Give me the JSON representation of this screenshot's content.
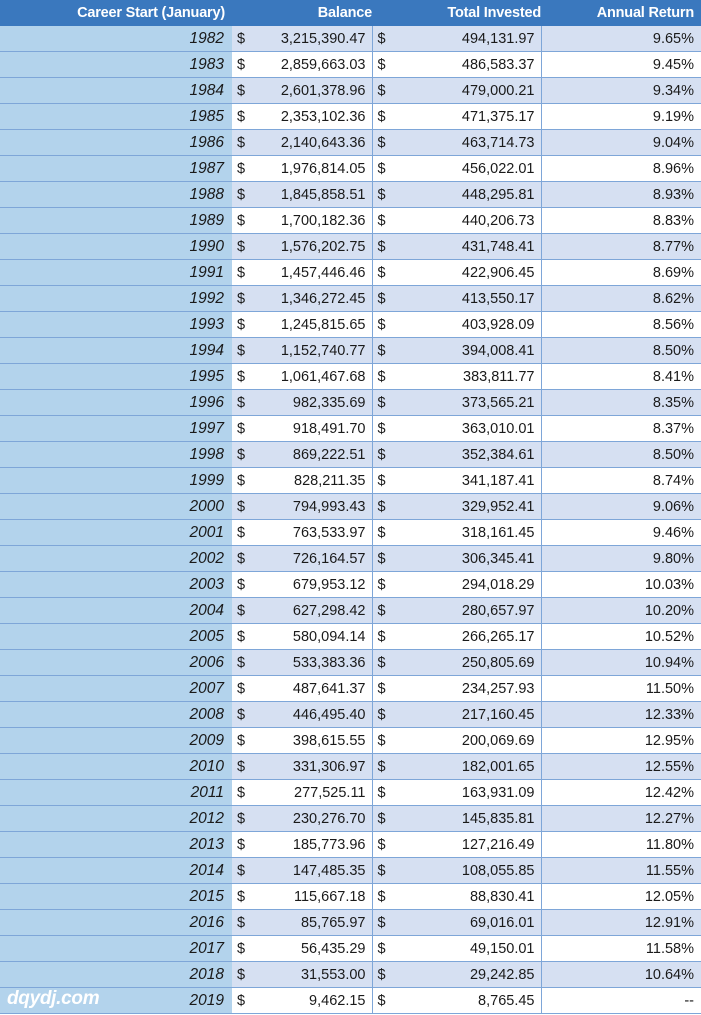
{
  "table": {
    "headers": {
      "year": "Career Start (January)",
      "balance": "Balance",
      "invested": "Total Invested",
      "return": "Annual Return"
    },
    "currency_symbol": "$",
    "rows": [
      {
        "year": "1982",
        "balance": "3,215,390.47",
        "invested": "494,131.97",
        "return": "9.65%"
      },
      {
        "year": "1983",
        "balance": "2,859,663.03",
        "invested": "486,583.37",
        "return": "9.45%"
      },
      {
        "year": "1984",
        "balance": "2,601,378.96",
        "invested": "479,000.21",
        "return": "9.34%"
      },
      {
        "year": "1985",
        "balance": "2,353,102.36",
        "invested": "471,375.17",
        "return": "9.19%"
      },
      {
        "year": "1986",
        "balance": "2,140,643.36",
        "invested": "463,714.73",
        "return": "9.04%"
      },
      {
        "year": "1987",
        "balance": "1,976,814.05",
        "invested": "456,022.01",
        "return": "8.96%"
      },
      {
        "year": "1988",
        "balance": "1,845,858.51",
        "invested": "448,295.81",
        "return": "8.93%"
      },
      {
        "year": "1989",
        "balance": "1,700,182.36",
        "invested": "440,206.73",
        "return": "8.83%"
      },
      {
        "year": "1990",
        "balance": "1,576,202.75",
        "invested": "431,748.41",
        "return": "8.77%"
      },
      {
        "year": "1991",
        "balance": "1,457,446.46",
        "invested": "422,906.45",
        "return": "8.69%"
      },
      {
        "year": "1992",
        "balance": "1,346,272.45",
        "invested": "413,550.17",
        "return": "8.62%"
      },
      {
        "year": "1993",
        "balance": "1,245,815.65",
        "invested": "403,928.09",
        "return": "8.56%"
      },
      {
        "year": "1994",
        "balance": "1,152,740.77",
        "invested": "394,008.41",
        "return": "8.50%"
      },
      {
        "year": "1995",
        "balance": "1,061,467.68",
        "invested": "383,811.77",
        "return": "8.41%"
      },
      {
        "year": "1996",
        "balance": "982,335.69",
        "invested": "373,565.21",
        "return": "8.35%"
      },
      {
        "year": "1997",
        "balance": "918,491.70",
        "invested": "363,010.01",
        "return": "8.37%"
      },
      {
        "year": "1998",
        "balance": "869,222.51",
        "invested": "352,384.61",
        "return": "8.50%"
      },
      {
        "year": "1999",
        "balance": "828,211.35",
        "invested": "341,187.41",
        "return": "8.74%"
      },
      {
        "year": "2000",
        "balance": "794,993.43",
        "invested": "329,952.41",
        "return": "9.06%"
      },
      {
        "year": "2001",
        "balance": "763,533.97",
        "invested": "318,161.45",
        "return": "9.46%"
      },
      {
        "year": "2002",
        "balance": "726,164.57",
        "invested": "306,345.41",
        "return": "9.80%"
      },
      {
        "year": "2003",
        "balance": "679,953.12",
        "invested": "294,018.29",
        "return": "10.03%"
      },
      {
        "year": "2004",
        "balance": "627,298.42",
        "invested": "280,657.97",
        "return": "10.20%"
      },
      {
        "year": "2005",
        "balance": "580,094.14",
        "invested": "266,265.17",
        "return": "10.52%"
      },
      {
        "year": "2006",
        "balance": "533,383.36",
        "invested": "250,805.69",
        "return": "10.94%"
      },
      {
        "year": "2007",
        "balance": "487,641.37",
        "invested": "234,257.93",
        "return": "11.50%"
      },
      {
        "year": "2008",
        "balance": "446,495.40",
        "invested": "217,160.45",
        "return": "12.33%"
      },
      {
        "year": "2009",
        "balance": "398,615.55",
        "invested": "200,069.69",
        "return": "12.95%"
      },
      {
        "year": "2010",
        "balance": "331,306.97",
        "invested": "182,001.65",
        "return": "12.55%"
      },
      {
        "year": "2011",
        "balance": "277,525.11",
        "invested": "163,931.09",
        "return": "12.42%"
      },
      {
        "year": "2012",
        "balance": "230,276.70",
        "invested": "145,835.81",
        "return": "12.27%"
      },
      {
        "year": "2013",
        "balance": "185,773.96",
        "invested": "127,216.49",
        "return": "11.80%"
      },
      {
        "year": "2014",
        "balance": "147,485.35",
        "invested": "108,055.85",
        "return": "11.55%"
      },
      {
        "year": "2015",
        "balance": "115,667.18",
        "invested": "88,830.41",
        "return": "12.05%"
      },
      {
        "year": "2016",
        "balance": "85,765.97",
        "invested": "69,016.01",
        "return": "12.91%"
      },
      {
        "year": "2017",
        "balance": "56,435.29",
        "invested": "49,150.01",
        "return": "11.58%"
      },
      {
        "year": "2018",
        "balance": "31,553.00",
        "invested": "29,242.85",
        "return": "10.64%"
      },
      {
        "year": "2019",
        "balance": "9,462.15",
        "invested": "8,765.45",
        "return": "--"
      }
    ]
  },
  "watermark": {
    "text": "dqydj.com"
  },
  "colors": {
    "header_bg": "#3a78be",
    "header_text": "#ffffff",
    "year_bg": "#b3d3ec",
    "band_bg": "#d6e0f2",
    "plain_bg": "#ffffff",
    "gridline": "#7ea6d8"
  }
}
